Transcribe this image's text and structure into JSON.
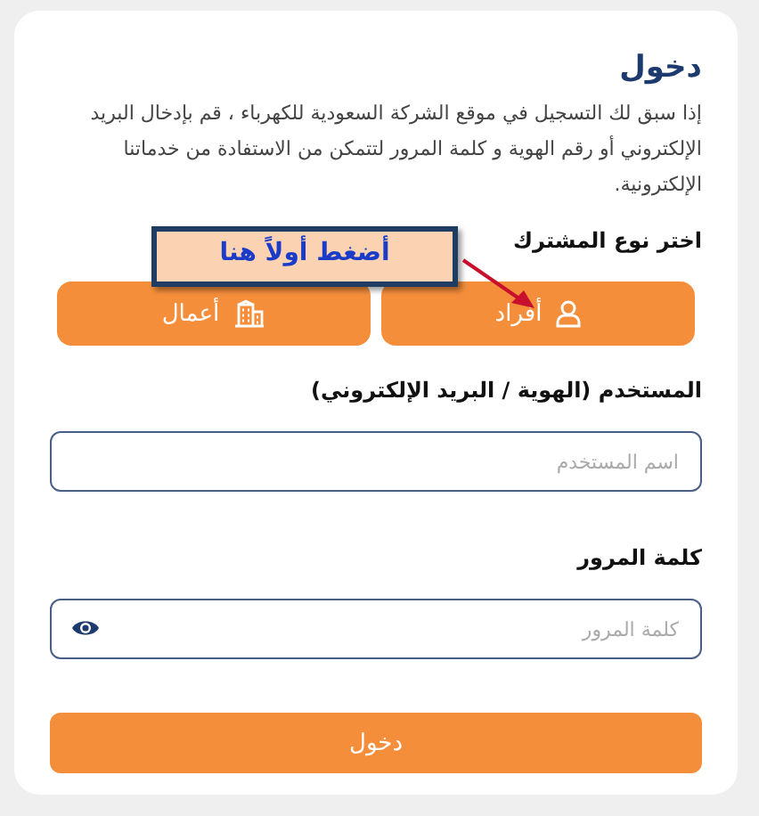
{
  "title": "دخول",
  "intro": "إذا سبق لك التسجيل في موقع الشركة السعودية للكهرباء ، قم بإدخال البريد الإلكتروني أو رقم الهوية و كلمة المرور لتتمكن من الاستفادة من خدماتنا الإلكترونية.",
  "subscriber_type": {
    "label": "اختر نوع المشترك",
    "options": [
      {
        "label": "أفراد",
        "kind": "person"
      },
      {
        "label": "أعمال",
        "kind": "business"
      }
    ]
  },
  "callout": "أضغط أولاً هنا",
  "username": {
    "label": "المستخدم (الهوية / البريد الإلكتروني)",
    "placeholder": "اسم المستخدم"
  },
  "password": {
    "label": "كلمة المرور",
    "placeholder": "كلمة المرور"
  },
  "submit": "دخول"
}
